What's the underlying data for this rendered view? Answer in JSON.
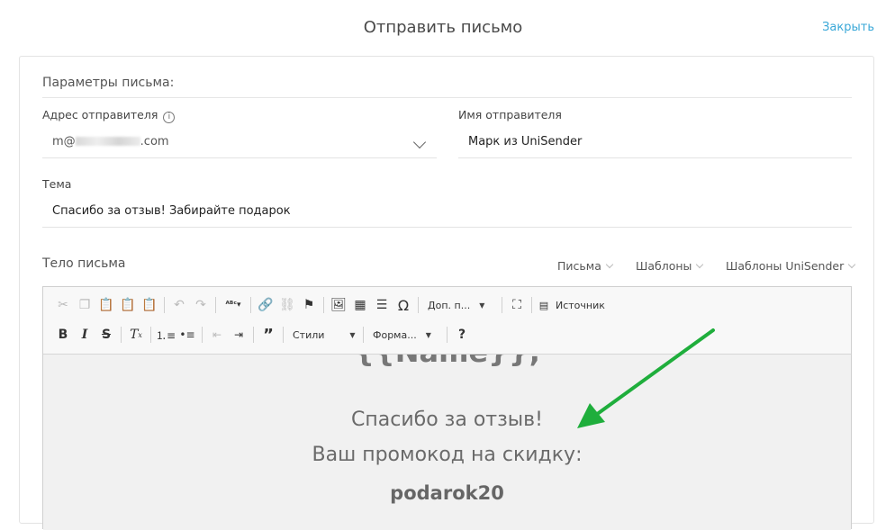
{
  "header": {
    "title": "Отправить письмо",
    "close_label": "Закрыть"
  },
  "params": {
    "section_title": "Параметры письма:",
    "sender_address": {
      "label": "Адрес отправителя",
      "value_prefix": "m@",
      "value_suffix": ".com"
    },
    "sender_name": {
      "label": "Имя отправителя",
      "value": "Марк из UniSender"
    },
    "subject": {
      "label": "Тема",
      "value": "Спасибо за отзыв! Забирайте подарок"
    }
  },
  "body": {
    "label": "Тело письма",
    "templates": [
      "Письма",
      "Шаблоны",
      "Шаблоны UniSender"
    ]
  },
  "toolbar": {
    "more_combo": "Доп. п...",
    "source_label": "Источник",
    "styles_combo": "Стили",
    "format_combo": "Форма..."
  },
  "content": {
    "name_tag": "{{Name}},",
    "line1": "Спасибо за отзыв!",
    "line2": "Ваш промокод на скидку:",
    "promo_code": "podarok20"
  },
  "colors": {
    "accent": "#3aa8d8",
    "arrow": "#1fae3c"
  }
}
